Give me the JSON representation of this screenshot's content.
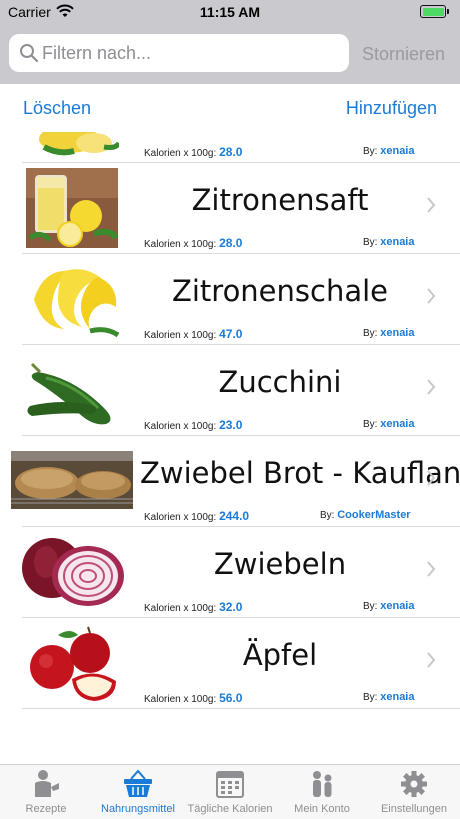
{
  "status": {
    "carrier": "Carrier",
    "time": "11:15 AM"
  },
  "search": {
    "placeholder": "Filtern nach...",
    "cancel": "Stornieren"
  },
  "nav": {
    "left": "Löschen",
    "right": "Hinzufügen"
  },
  "partial_row": {
    "kal_label": "Kalorien x 100g:",
    "kal_value": "28.0",
    "by_label": "By:",
    "by_value": "xenaia"
  },
  "rows": [
    {
      "title": "Zitronensaft",
      "kal_label": "Kalorien x 100g:",
      "kal_value": "28.0",
      "by_label": "By:",
      "by_value": "xenaia",
      "image": "lemon-juice-image"
    },
    {
      "title": "Zitronenschale",
      "kal_label": "Kalorien x 100g:",
      "kal_value": "47.0",
      "by_label": "By:",
      "by_value": "xenaia",
      "image": "lemon-peel-image"
    },
    {
      "title": "Zucchini",
      "kal_label": "Kalorien x 100g:",
      "kal_value": "23.0",
      "by_label": "By:",
      "by_value": "xenaia",
      "image": "zucchini-image"
    },
    {
      "title": "Zwiebel Brot - Kaufland",
      "kal_label": "Kalorien x 100g:",
      "kal_value": "244.0",
      "by_label": "By:",
      "by_value": "CookerMaster",
      "image": "onion-bread-image"
    },
    {
      "title": "Zwiebeln",
      "kal_label": "Kalorien x 100g:",
      "kal_value": "32.0",
      "by_label": "By:",
      "by_value": "xenaia",
      "image": "onion-image"
    },
    {
      "title": "Äpfel",
      "kal_label": "Kalorien x 100g:",
      "kal_value": "56.0",
      "by_label": "By:",
      "by_value": "xenaia",
      "image": "apple-image"
    }
  ],
  "tabs": [
    {
      "label": "Rezepte",
      "icon": "chef-icon"
    },
    {
      "label": "Nahrungsmittel",
      "icon": "basket-icon",
      "active": true
    },
    {
      "label": "Tägliche Kalorien",
      "icon": "calendar-icon"
    },
    {
      "label": "Mein Konto",
      "icon": "people-icon"
    },
    {
      "label": "Einstellungen",
      "icon": "gear-icon"
    }
  ],
  "colors": {
    "accent": "#1a7bd6",
    "bar_gray": "#c9c9ce",
    "tab_inactive": "#8e8e93"
  }
}
